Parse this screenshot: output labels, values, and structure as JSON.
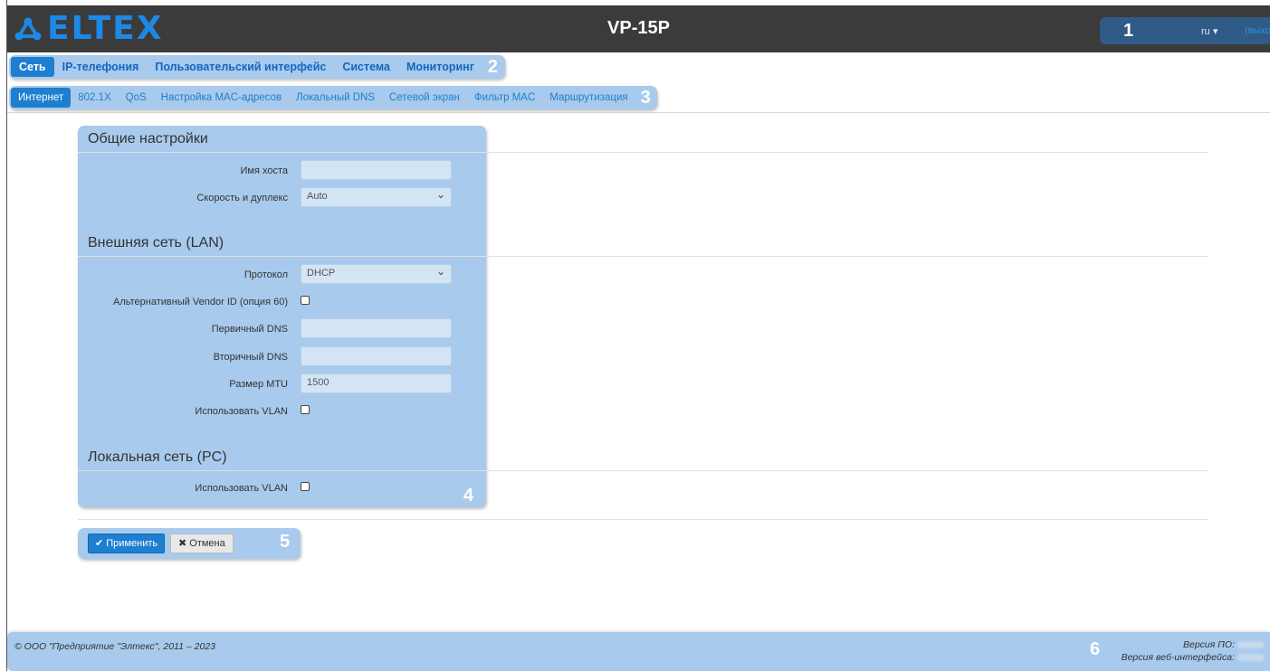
{
  "header": {
    "logo_text": "ELTEX",
    "device_title": "VP-15P",
    "badge_number": "1",
    "language": "ru ▾",
    "logout": "(выход)"
  },
  "main_tabs": {
    "items": [
      "Сеть",
      "IP-телефония",
      "Пользовательский интерфейс",
      "Система",
      "Мониторинг"
    ],
    "active": "Сеть",
    "badge_number": "2"
  },
  "sub_tabs": {
    "items": [
      "Интернет",
      "802.1X",
      "QoS",
      "Настройка MAC-адресов",
      "Локальный DNS",
      "Сетевой экран",
      "Фильтр MAC",
      "Маршрутизация"
    ],
    "active": "Интернет",
    "badge_number": "3"
  },
  "form": {
    "badge_number": "4",
    "general": {
      "title": "Общие настройки",
      "hostname_label": "Имя хоста",
      "hostname_value": "",
      "speed_label": "Скорость и дуплекс",
      "speed_value": "Auto"
    },
    "wan": {
      "title": "Внешняя сеть (LAN)",
      "protocol_label": "Протокол",
      "protocol_value": "DHCP",
      "vendor_id_label": "Альтернативный Vendor ID (опция 60)",
      "vendor_id_checked": false,
      "dns1_label": "Первичный DNS",
      "dns1_value": "",
      "dns2_label": "Вторичный DNS",
      "dns2_value": "",
      "mtu_label": "Размер MTU",
      "mtu_value": "1500",
      "vlan_label": "Использовать VLAN",
      "vlan_checked": false
    },
    "lan": {
      "title": "Локальная сеть (PC)",
      "vlan_label": "Использовать VLAN",
      "vlan_checked": false
    }
  },
  "actions": {
    "apply_label": "✔ Применить",
    "cancel_label": "✖ Отмена",
    "badge_number": "5"
  },
  "footer": {
    "copyright": "© ООО \"Предприятие \"Элтекс\", 2011 – 2023",
    "fw_version_label": "Версия ПО:",
    "web_version_label": "Версия веб-интерфейса:",
    "badge_number": "6"
  },
  "colors": {
    "header_bg": "#3b3b3b",
    "accent": "#1e7fd0",
    "highlight": "#a8caec",
    "logo": "#1e88e5"
  }
}
